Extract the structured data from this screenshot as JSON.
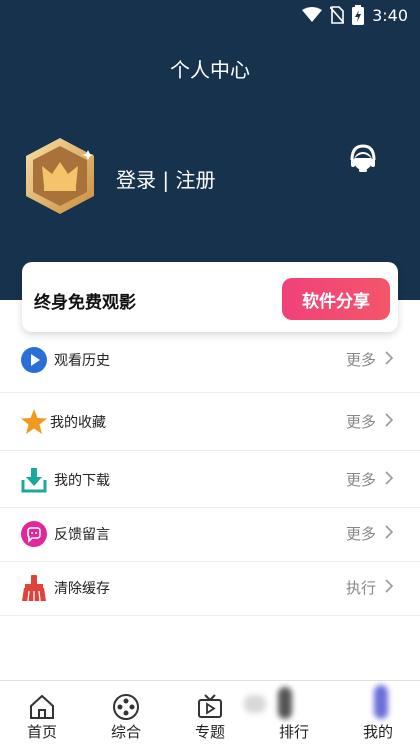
{
  "status_bar": {
    "time": "3:40"
  },
  "header": {
    "title": "个人中心",
    "login_text": "登录 | 注册"
  },
  "promo": {
    "title": "终身免费观影",
    "share_button": "软件分享"
  },
  "menu": [
    {
      "label": "观看历史",
      "action": "更多",
      "icon": "play-icon"
    },
    {
      "label": "我的收藏",
      "action": "更多",
      "icon": "star-icon"
    },
    {
      "label": "我的下载",
      "action": "更多",
      "icon": "download-icon"
    },
    {
      "label": "反馈留言",
      "action": "更多",
      "icon": "feedback-icon"
    },
    {
      "label": "清除缓存",
      "action": "执行",
      "icon": "broom-icon"
    }
  ],
  "bottom_nav": [
    {
      "label": "首页",
      "icon": "home-icon"
    },
    {
      "label": "综合",
      "icon": "film-reel-icon"
    },
    {
      "label": "专题",
      "icon": "tv-icon"
    },
    {
      "label": "排行",
      "icon": "ranking-icon"
    },
    {
      "label": "我的",
      "icon": "profile-icon"
    }
  ],
  "colors": {
    "header_bg": "#17324d",
    "share_button": "#f0427a",
    "play_icon": "#2a6fd6",
    "star_icon": "#f29a1f",
    "download_icon": "#1ba89a",
    "feedback_icon": "#e0289a",
    "broom_icon": "#e0433a"
  }
}
